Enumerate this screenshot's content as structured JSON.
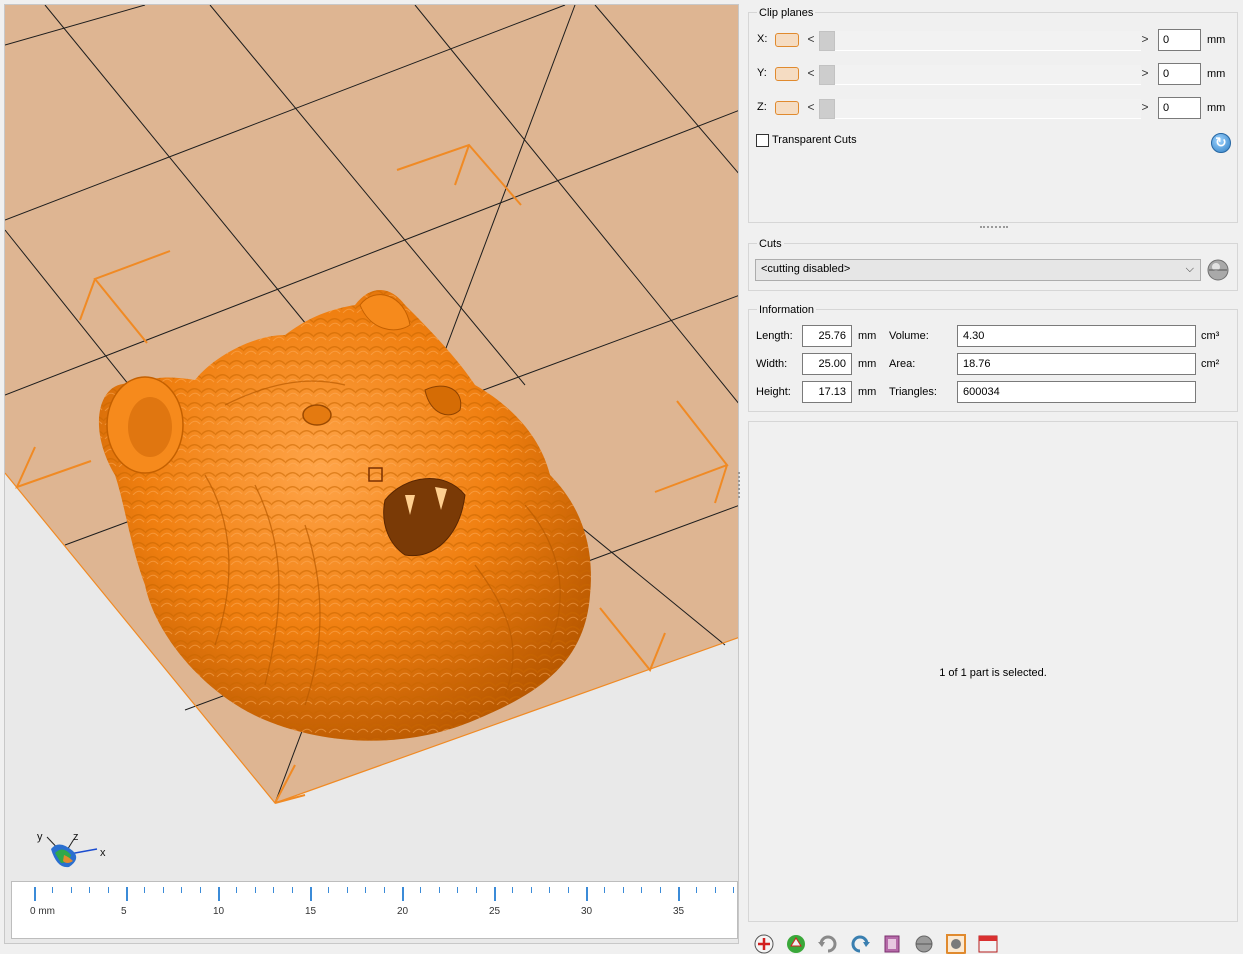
{
  "viewport": {
    "axis_labels": {
      "x": "x",
      "y": "y",
      "z": "z"
    },
    "ruler": {
      "labels": [
        {
          "value": 0,
          "text": "0 mm"
        },
        {
          "value": 5,
          "text": "5"
        },
        {
          "value": 10,
          "text": "10"
        },
        {
          "value": 15,
          "text": "15"
        },
        {
          "value": 20,
          "text": "20"
        },
        {
          "value": 25,
          "text": "25"
        },
        {
          "value": 30,
          "text": "30"
        },
        {
          "value": 35,
          "text": "35"
        }
      ]
    },
    "colors": {
      "model": "#f07f10",
      "plate": "#deb592",
      "grid_line": "#1d1d1d",
      "accent": "#f08a24"
    }
  },
  "clip_planes": {
    "title": "Clip planes",
    "rows": [
      {
        "axis": "X:",
        "value": "0",
        "unit": "mm"
      },
      {
        "axis": "Y:",
        "value": "0",
        "unit": "mm"
      },
      {
        "axis": "Z:",
        "value": "0",
        "unit": "mm"
      }
    ],
    "left_arrow": "<",
    "right_arrow": ">",
    "transparent_cuts_label": "Transparent Cuts",
    "transparent_cuts_checked": false
  },
  "cuts": {
    "title": "Cuts",
    "selected": "<cutting disabled>"
  },
  "information": {
    "title": "Information",
    "length_label": "Length:",
    "length_value": "25.76",
    "length_unit": "mm",
    "width_label": "Width:",
    "width_value": "25.00",
    "width_unit": "mm",
    "height_label": "Height:",
    "height_value": "17.13",
    "height_unit": "mm",
    "volume_label": "Volume:",
    "volume_value": "4.30",
    "volume_unit": "cm³",
    "area_label": "Area:",
    "area_value": "18.76",
    "area_unit": "cm²",
    "triangles_label": "Triangles:",
    "triangles_value": "600034"
  },
  "status": {
    "selection_text": "1 of 1 part is selected."
  },
  "toolbar": {
    "icons": [
      "add-part-icon",
      "repair-icon",
      "undo-icon",
      "redo-icon",
      "box-view-icon",
      "sphere-view-icon",
      "part-view-icon",
      "calendar-icon"
    ]
  }
}
